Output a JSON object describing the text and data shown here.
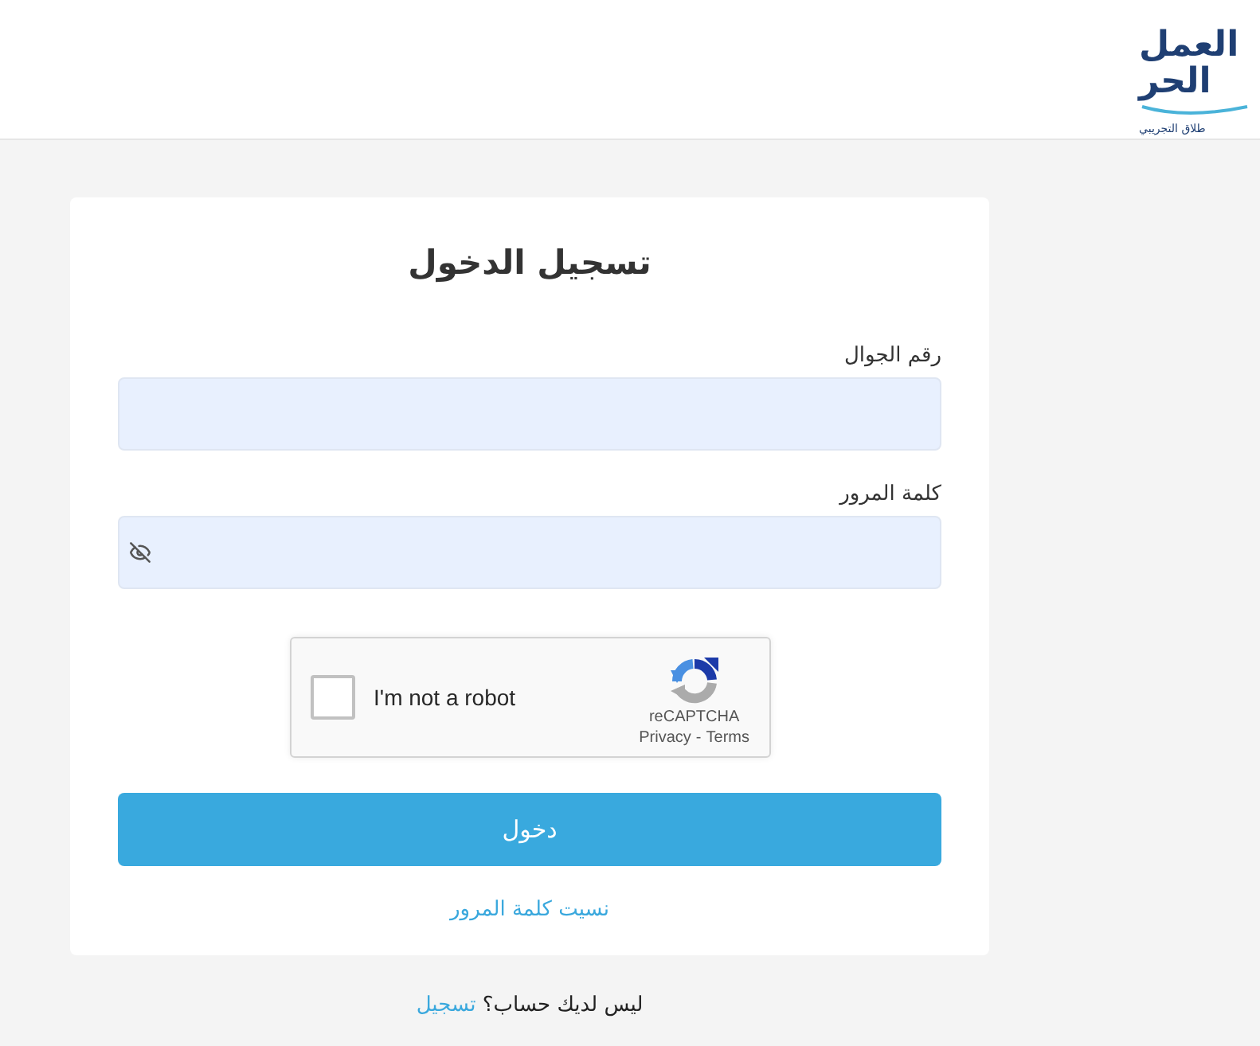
{
  "header": {
    "logo": {
      "line_1": "العمل",
      "line_2": "الحر",
      "tagline": "طلاق التجريبي"
    }
  },
  "login_card": {
    "title": "تسجيل الدخول",
    "fields": [
      {
        "label": "رقم الجوال",
        "kind": "text"
      },
      {
        "label": "كلمة المرور",
        "kind": "password"
      }
    ],
    "captcha": {
      "label": "I'm not a robot",
      "checked": false,
      "brand": "reCAPTCHA",
      "privacy_link": "Privacy",
      "separator": "-",
      "terms_link": "Terms"
    },
    "submit": "دخول",
    "forgot_link": "نسيت كلمة المرور"
  },
  "footer": {
    "text": "ليس لديك حساب؟",
    "link": "تسجيل"
  }
}
